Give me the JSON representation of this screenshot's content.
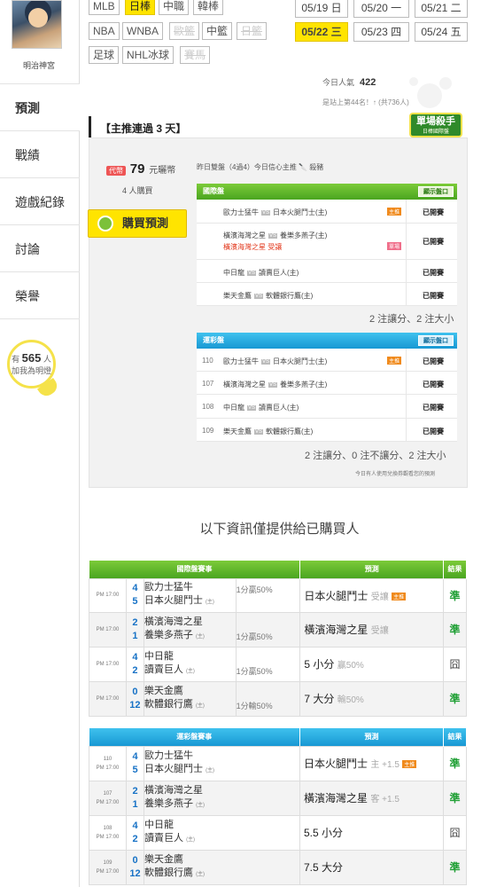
{
  "sidebar": {
    "username": "明治神宮",
    "nav": [
      "預測",
      "戰績",
      "遊戲紀錄",
      "討論",
      "榮譽"
    ],
    "popularity": {
      "prefix": "有",
      "count": "565",
      "suffix": "人",
      "caption": "加我為明燈"
    }
  },
  "filters": {
    "row1": [
      "MLB",
      "日棒",
      "中職",
      "韓棒"
    ],
    "row2": [
      "NBA",
      "WNBA",
      "歐籃",
      "中籃",
      "日籃"
    ],
    "row3": [
      "足球",
      "NHL冰球",
      "賽馬"
    ],
    "selected": "日棒"
  },
  "dates": [
    {
      "label": "05/19 日",
      "active": false
    },
    {
      "label": "05/20 一",
      "active": false
    },
    {
      "label": "05/21 二",
      "active": false
    },
    {
      "label": "05/22 三",
      "active": true
    },
    {
      "label": "05/23 四",
      "active": false
    },
    {
      "label": "05/24 五",
      "active": false
    }
  ],
  "stats": {
    "today_label": "今日人氣",
    "today_value": "422",
    "rank": "是站上第44名！↑ (共736人)"
  },
  "panel": {
    "title": "【主推連過 3 天】",
    "badge": "單場殺手",
    "badge_sub": "日棒國際盤",
    "price_tag": "代幣",
    "price": "79",
    "price_unit": "元曬幣",
    "buyers": "4 人購買",
    "buy_button": "購買預測",
    "summary": "昨日雙盤（4過4）今日信心主推 🔪 殺豬",
    "show_label": "顯示盤口",
    "intl": {
      "title": "國際盤",
      "rows": [
        {
          "away": "歐力士猛牛",
          "home": "日本火腿鬥士(主)",
          "tag": "主推",
          "status": "已開賽"
        },
        {
          "away": "橫濱海灣之星",
          "home": "養樂多燕子(主)",
          "line2": "橫濱海灣之星  受讓",
          "tag": "單場",
          "status": "已開賽"
        },
        {
          "away": "中日龍",
          "home": "讀賣巨人(主)",
          "status": "已開賽"
        },
        {
          "away": "樂天金鷹",
          "home": "軟體銀行鷹(主)",
          "status": "已開賽"
        }
      ],
      "footer": "2 注讓分、2 注大小"
    },
    "lottery": {
      "title": "運彩盤",
      "rows": [
        {
          "no": "110",
          "away": "歐力士猛牛",
          "home": "日本火腿鬥士(主)",
          "tag": "主推",
          "status": "已開賽"
        },
        {
          "no": "107",
          "away": "橫濱海灣之星",
          "home": "養樂多燕子(主)",
          "status": "已開賽"
        },
        {
          "no": "108",
          "away": "中日龍",
          "home": "讀賣巨人(主)",
          "status": "已開賽"
        },
        {
          "no": "109",
          "away": "樂天金鷹",
          "home": "軟體銀行鷹(主)",
          "status": "已開賽"
        }
      ],
      "footer": "2 注讓分、0 注不讓分、2 注大小"
    },
    "note": "今日有人使用兌換券觀看您的預測"
  },
  "info_line": "以下資訊僅提供給已購買人",
  "intl_table": {
    "headers": [
      "國際盤賽事",
      "預測",
      "結果"
    ],
    "rows": [
      {
        "time": "PM 17:00",
        "s1": "4",
        "s2": "5",
        "t1": "歐力士猛牛",
        "t2": "日本火腿鬥士",
        "line": "1分贏50%",
        "line_pos": "top",
        "pred": "日本火腿鬥士",
        "pred_sub": "受讓",
        "tag": "主推",
        "result": "準",
        "result_type": "ok"
      },
      {
        "time": "PM 17:00",
        "s1": "2",
        "s2": "1",
        "t1": "橫濱海灣之星",
        "t2": "養樂多燕子",
        "line": "1分贏50%",
        "line_pos": "bottom",
        "pred": "橫濱海灣之星",
        "pred_sub": "受讓",
        "result": "準",
        "result_type": "ok"
      },
      {
        "time": "PM 17:00",
        "s1": "4",
        "s2": "2",
        "t1": "中日龍",
        "t2": "讀賣巨人",
        "line": "1分贏50%",
        "line_pos": "bottom",
        "pred": "5 小分",
        "pred_sub": "贏50%",
        "result": "囧",
        "result_type": "draw"
      },
      {
        "time": "PM 17:00",
        "s1": "0",
        "s2": "12",
        "t1": "樂天金鷹",
        "t2": "軟體銀行鷹",
        "line": "1分輸50%",
        "line_pos": "bottom",
        "pred": "7 大分",
        "pred_sub": "輸50%",
        "result": "準",
        "result_type": "ok"
      }
    ]
  },
  "lottery_table": {
    "headers": [
      "運彩盤賽事",
      "預測",
      "結果"
    ],
    "rows": [
      {
        "no": "110",
        "time": "PM 17:00",
        "s1": "4",
        "s2": "5",
        "t1": "歐力士猛牛",
        "t2": "日本火腿鬥士",
        "pred": "日本火腿鬥士",
        "pred_sub": "主 +1.5",
        "tag": "主推",
        "result": "準",
        "result_type": "ok"
      },
      {
        "no": "107",
        "time": "PM 17:00",
        "s1": "2",
        "s2": "1",
        "t1": "橫濱海灣之星",
        "t2": "養樂多燕子",
        "pred": "橫濱海灣之星",
        "pred_sub": "客 +1.5",
        "result": "準",
        "result_type": "ok"
      },
      {
        "no": "108",
        "time": "PM 17:00",
        "s1": "4",
        "s2": "2",
        "t1": "中日龍",
        "t2": "讀賣巨人",
        "pred": "5.5 小分",
        "pred_sub": "",
        "result": "囧",
        "result_type": "draw"
      },
      {
        "no": "109",
        "time": "PM 17:00",
        "s1": "0",
        "s2": "12",
        "t1": "樂天金鷹",
        "t2": "軟體銀行鷹",
        "pred": "7.5 大分",
        "pred_sub": "",
        "result": "準",
        "result_type": "ok"
      }
    ]
  },
  "home_mark": "(主)"
}
